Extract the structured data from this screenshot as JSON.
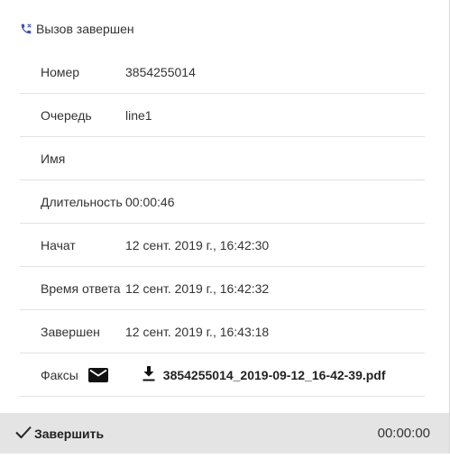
{
  "header": {
    "icon": "phone-ended-icon",
    "title": "Вызов завершен",
    "accent": "#3f51b5"
  },
  "details": {
    "number_label": "Номер",
    "number_value": "3854255014",
    "queue_label": "Очередь",
    "queue_value": "line1",
    "name_label": "Имя",
    "name_value": "",
    "duration_label": "Длительность",
    "duration_value": "00:00:46",
    "started_label": "Начат",
    "started_value": "12 сент. 2019 г., 16:42:30",
    "answered_label": "Время ответа",
    "answered_value": "12 сент. 2019 г., 16:42:32",
    "ended_label": "Завершен",
    "ended_value": "12 сент. 2019 г., 16:43:18",
    "faxes_label": "Факсы",
    "fax_file": "3854255014_2019-09-12_16-42-39.pdf"
  },
  "footer": {
    "finish_label": "Завершить",
    "timer": "00:00:00",
    "background": "#e4e4e4"
  }
}
